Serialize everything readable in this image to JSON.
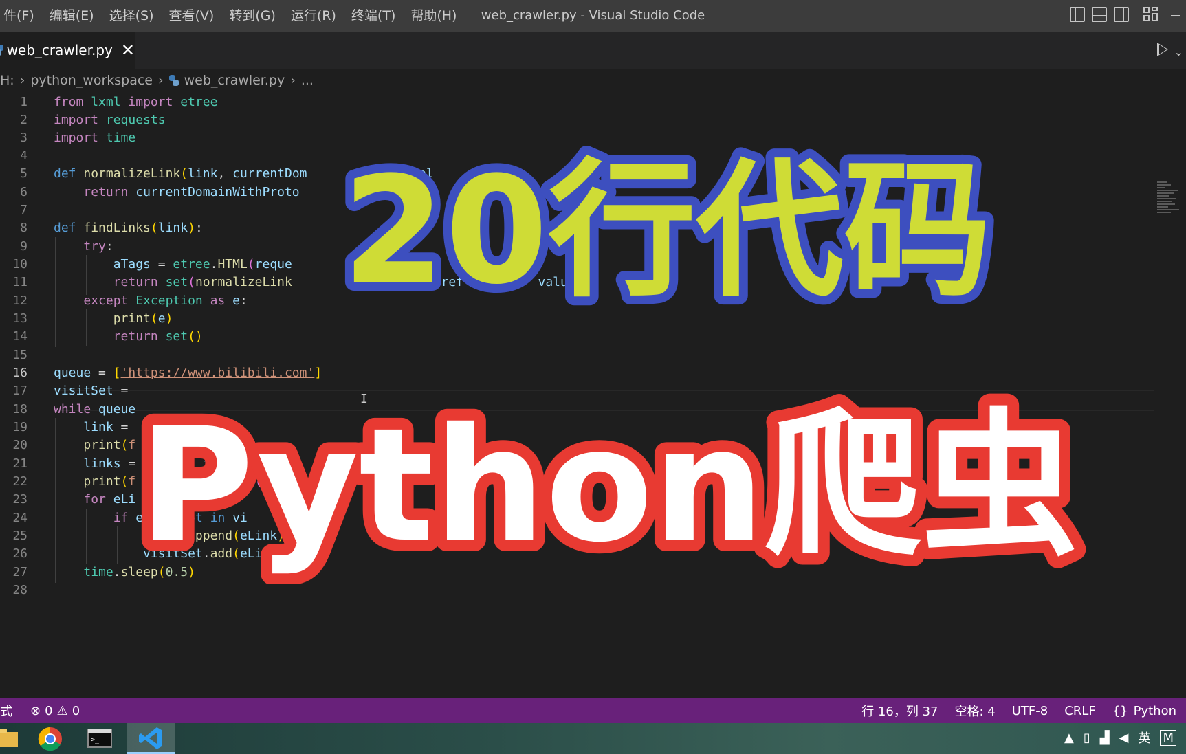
{
  "titlebar": {
    "menu": [
      "件(F)",
      "编辑(E)",
      "选择(S)",
      "查看(V)",
      "转到(G)",
      "运行(R)",
      "终端(T)",
      "帮助(H)"
    ],
    "window_title": "web_crawler.py - Visual Studio Code"
  },
  "tab": {
    "label": "web_crawler.py",
    "close": "✕"
  },
  "breadcrumb": {
    "drive": "H:",
    "folder": "python_workspace",
    "file": "web_crawler.py",
    "more": "..."
  },
  "editor": {
    "current_line": 16,
    "lines": [
      "1",
      "2",
      "3",
      "4",
      "5",
      "6",
      "7",
      "8",
      "9",
      "10",
      "11",
      "12",
      "13",
      "14",
      "15",
      "16",
      "17",
      "18",
      "19",
      "20",
      "21",
      "22",
      "23",
      "24",
      "25",
      "26",
      "27",
      "28"
    ]
  },
  "overlay": {
    "top_text": "20行代码",
    "bottom_text": "Python爬虫"
  },
  "statusbar": {
    "mode": "式",
    "errors": "0",
    "warnings": "0",
    "position": "行 16，列 37",
    "spaces": "空格: 4",
    "encoding": "UTF-8",
    "eol": "CRLF",
    "language": "Python"
  },
  "taskbar": {
    "ime": "英",
    "ime2": "M"
  }
}
